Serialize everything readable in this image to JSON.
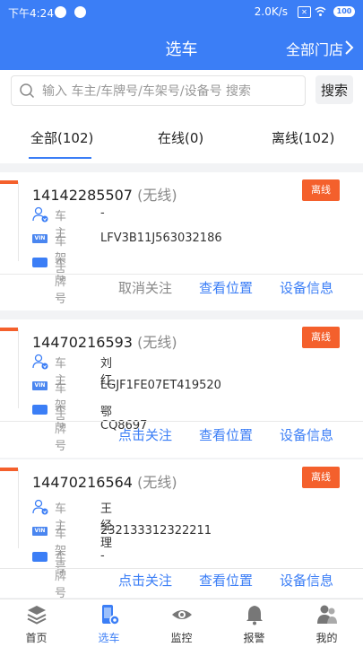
{
  "statusbar": {
    "time": "下午4:24",
    "speed": "2.0K/s",
    "battery": "100"
  },
  "header": {
    "title": "选车",
    "store": "全部门店"
  },
  "search": {
    "placeholder": "输入 车主/车牌号/车架号/设备号 搜索",
    "button": "搜索"
  },
  "tabs": [
    {
      "label": "全部(102)"
    },
    {
      "label": "在线(0)"
    },
    {
      "label": "离线(102)"
    }
  ],
  "labels": {
    "owner": "车主",
    "vin": "车架号",
    "plate": "车牌号",
    "vin_badge": "VIN"
  },
  "actions": {
    "location": "查看位置",
    "device": "设备信息"
  },
  "vehicles": [
    {
      "device_no": "14142285507",
      "signal": "(无线)",
      "status": "离线",
      "owner": "-",
      "vin": "LFV3B11J563032186",
      "plate": "",
      "follow": "取消关注"
    },
    {
      "device_no": "14470216593",
      "signal": "(无线)",
      "status": "离线",
      "owner": "刘红",
      "vin": "LGJF1FE07ET419520",
      "plate": "鄂CQ8697",
      "follow": "点击关注"
    },
    {
      "device_no": "14470216564",
      "signal": "(无线)",
      "status": "离线",
      "owner": "王经理",
      "vin": "232133312322211",
      "plate": "-",
      "follow": "点击关注"
    }
  ],
  "tabbar": [
    {
      "label": "首页",
      "icon": "layers-icon"
    },
    {
      "label": "选车",
      "icon": "car-select-icon"
    },
    {
      "label": "监控",
      "icon": "eye-icon"
    },
    {
      "label": "报警",
      "icon": "bell-icon"
    },
    {
      "label": "我的",
      "icon": "user-icon"
    }
  ],
  "colors": {
    "primary": "#3b7ef6",
    "offline": "#f4602c",
    "background": "#f2f3f5"
  }
}
